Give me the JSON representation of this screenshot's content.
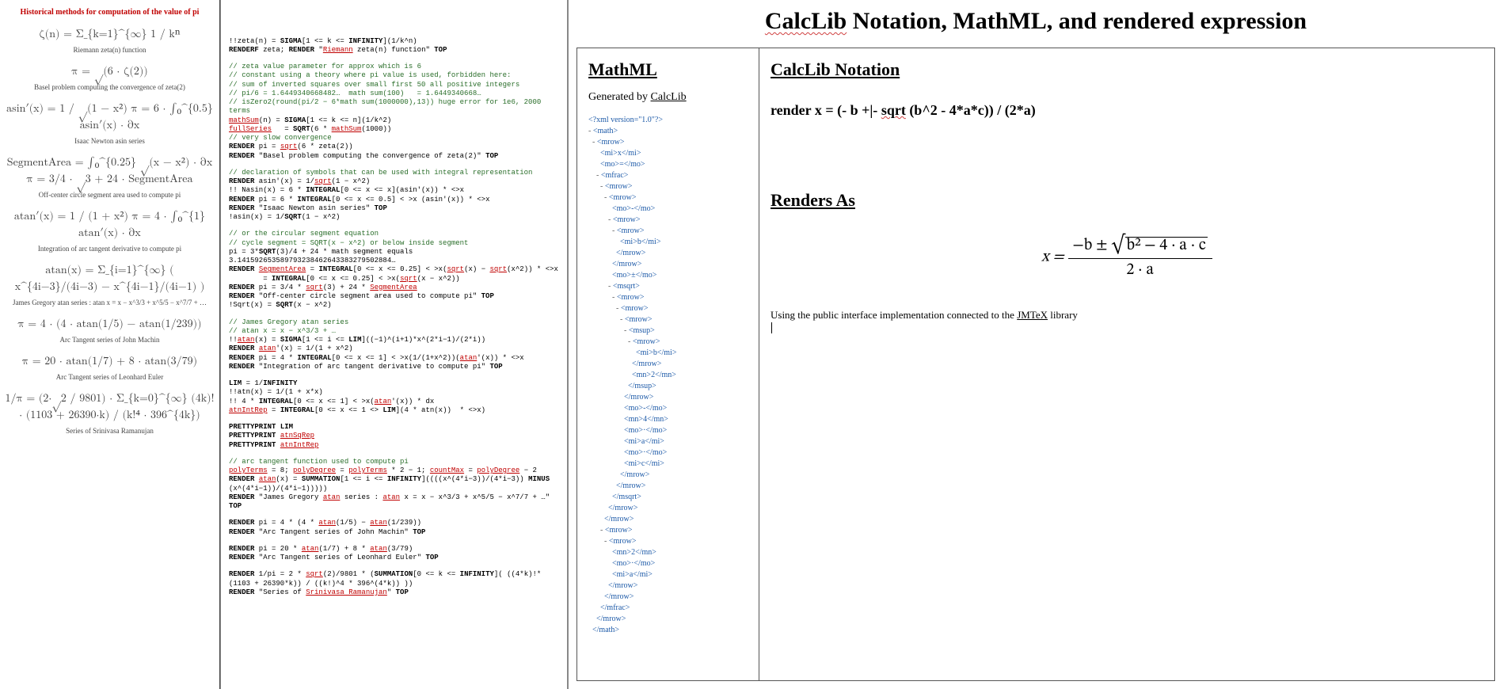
{
  "left": {
    "title": "Historical methods for computation of the value of pi",
    "items": [
      {
        "formula": "ζ(n) = Σ_{k=1}^{∞} 1 / kⁿ",
        "caption": "Riemann zeta(n) function"
      },
      {
        "formula": "π = √(6 · ζ(2))",
        "caption": "Basel problem computing the convergence of zeta(2)"
      },
      {
        "formula": "asin′(x) = 1 / √(1 − x²)\nπ = 6 · ∫₀^{0.5} asin′(x) · ∂x",
        "caption": "Isaac Newton asin series"
      },
      {
        "formula": "SegmentArea = ∫₀^{0.25} √(x − x²) · ∂x\nπ = 3/4 · √3 + 24 · SegmentArea",
        "caption": "Off-center circle segment area used to compute pi"
      },
      {
        "formula": "atan′(x) = 1 / (1 + x²)\nπ = 4 · ∫₀^{1} atan′(x) · ∂x",
        "caption": "Integration of arc tangent derivative to compute pi"
      },
      {
        "formula": "atan(x) = Σ_{i=1}^{∞} ( x^{4i−3}/(4i−3) − x^{4i−1}/(4i−1) )",
        "caption": "James Gregory atan series : atan x = x − x^3/3 + x^5/5 − x^7/7 + …"
      },
      {
        "formula": "π = 4 · (4 · atan(1/5) − atan(1/239))",
        "caption": "Arc Tangent series of John Machin"
      },
      {
        "formula": "π = 20 · atan(1/7) + 8 · atan(3/79)",
        "caption": "Arc Tangent series of Leonhard Euler"
      },
      {
        "formula": "1/π = (2·√2 / 9801) · Σ_{k=0}^{∞} (4k)! · (1103 + 26390·k) / (k!⁴ · 396^{4k})",
        "caption": "Series of Srinivasa Ramanujan"
      }
    ]
  },
  "middle": {
    "blocks": [
      [
        "!!zeta(n) = SIGMA[1 <= k <= INFINITY](1/k^n)",
        "RENDERF zeta; RENDER \"{Riemann} zeta(n) function\" TOP"
      ],
      [
        "// zeta value parameter for approx which is 6",
        "// constant using a theory where pi value is used, forbidden here:",
        "// sum of inverted squares over small first 50 all positive integers",
        "// pi/6 = 1.6449340668482…  math sum(100)   = 1.6449340668…",
        "// isZero2(round(pi/2 − 6*math sum(1000000),13)) huge error for 1e6, 2000 terms",
        "{mathSum}(n) = SIGMA[1 <= k <= n](1/k^2)",
        "{fullSeries}   = SQRT(6 * {mathSum}(1000))",
        "// very slow convergence",
        "RENDER pi = sqrt(6 * zeta(2))",
        "RENDER \"Basel problem computing the convergence of zeta(2)\" TOP"
      ],
      [
        "// declaration of symbols that can be used with integral representation",
        "",
        "RENDER asin'(x) = 1/sqrt(1 − x^2)",
        "!! Nasin(x) = 6 * INTEGRAL[0 <= x <= x](asin'(x)) * <>x",
        "RENDER pi = 6 * INTEGRAL[0 <= x <= 0.5] < >x (asin'(x)) * <>x",
        "RENDER \"Isaac Newton asin series\" TOP",
        "!asin(x) = 1/SQRT(1 − x^2)"
      ],
      [
        "// or the circular segment equation",
        "// cycle segment = SQRT(x − x^2) or below inside segment",
        "pi = 3*SQRT(3)/4 + 24 * math segment equals 3.141592653589793238462643383279502884…",
        "",
        "RENDER {SegmentArea} = INTEGRAL[0 <= x <= 0.25] < >x(sqrt(x) − sqrt(x^2)) * <>x",
        "        = INTEGRAL[0 <= x <= 0.25] < >x(sqrt(x − x^2))",
        "",
        "RENDER pi = 3/4 * sqrt(3) + 24 * {SegmentArea}",
        "RENDER \"Off-center circle segment area used to compute pi\" TOP",
        "!Sqrt(x) = SQRT(x − x^2)"
      ],
      [
        "// James Gregory atan series",
        "// atan x = x − x^3/3 + …",
        "!!atan(x) = SIGMA[1 <= i <= LIM]((−1)^(i+1)*x^(2*i−1)/(2*i))",
        "",
        "RENDER atan'(x) = 1/(1 + x^2)",
        "RENDER pi = 4 * INTEGRAL[0 <= x <= 1] < >x(1/(1+x^2))(atan'(x)) * <>x",
        "RENDER \"Integration of arc tangent derivative to compute pi\" TOP"
      ],
      [
        "LIM = 1/INFINITY",
        "!!atn(x) = 1/(1 + x*x)",
        "",
        "!! 4 * INTEGRAL[0 <= x <= 1] < >x(atan'(x)) * dx",
        "{atnIntRep} = INTEGRAL[0 <= x <= 1 <> LIM](4 * atn(x))  * <>x)"
      ],
      [
        "PRETTYPRINT LIM",
        "PRETTYPRINT {atnSqRep}",
        "PRETTYPRINT {atnIntRep}"
      ],
      [
        "// arc tangent function used to compute pi",
        "{polyTerms} = 8; {polyDegree} = {polyTerms} * 2 − 1; {countMax} = {polyDegree} − 2",
        "RENDER atan(x) = SUMMATION[1 <= i <= INFINITY]((((x^(4*i−3))/(4*i−3)) MINUS (x^(4*i−1))/(4*i−1)))))",
        "RENDER \"James Gregory atan series : atan x = x − x^3/3 + x^5/5 − x^7/7 + …\" TOP"
      ],
      [
        "RENDER pi = 4 * (4 * atan(1/5) − atan(1/239))",
        "RENDER \"Arc Tangent series of John Machin\" TOP"
      ],
      [
        "RENDER pi = 20 * atan(1/7) + 8 * atan(3/79)",
        "RENDER \"Arc Tangent series of Leonhard Euler\" TOP"
      ],
      [
        "RENDER 1/pi = 2 * sqrt(2)/9801 * (SUMMATION[0 <= k <= INFINITY]( ((4*k)!*(1103 + 26390*k)) / ((k!)^4 * 396^(4*k)) ))",
        "RENDER \"Series of {Srinivasa Ramanujan}\" TOP"
      ]
    ]
  },
  "right": {
    "title_parts": [
      "CalcLib",
      " Notation, MathML, and rendered expression"
    ],
    "mathml": {
      "heading": "MathML",
      "generated_prefix": "Generated by ",
      "generated_link": "CalcLib",
      "xml_lines": [
        "<?xml version=\"1.0\"?>",
        "- <math>",
        "  - <mrow>",
        "      <mi>x</mi>",
        "      <mo>=</mo>",
        "    - <mfrac>",
        "      - <mrow>",
        "        - <mrow>",
        "            <mo>-</mo>",
        "          - <mrow>",
        "            - <mrow>",
        "                <mi>b</mi>",
        "              </mrow>",
        "            </mrow>",
        "            <mo>±</mo>",
        "          - <msqrt>",
        "            - <mrow>",
        "              - <mrow>",
        "                - <mrow>",
        "                  - <msup>",
        "                    - <mrow>",
        "                        <mi>b</mi>",
        "                      </mrow>",
        "                      <mn>2</mn>",
        "                    </msup>",
        "                  </mrow>",
        "                  <mo>-</mo>",
        "                  <mn>4</mn>",
        "                  <mo>·</mo>",
        "                  <mi>a</mi>",
        "                  <mo>·</mo>",
        "                  <mi>c</mi>",
        "                </mrow>",
        "              </mrow>",
        "            </msqrt>",
        "          </mrow>",
        "        </mrow>",
        "      - <mrow>",
        "        - <mrow>",
        "            <mn>2</mn>",
        "            <mo>·</mo>",
        "            <mi>a</mi>",
        "          </mrow>",
        "        </mrow>",
        "      </mfrac>",
        "    </mrow>",
        "  </math>"
      ]
    },
    "calclib": {
      "heading": "CalcLib Notation",
      "notation": "render x = (- b +|- sqrt (b^2 - 4*a*c)) / (2*a)",
      "renders_heading": "Renders As",
      "formula": {
        "lhs": "x =",
        "num": "−b ± √(b² − 4·a·c)",
        "den": "2 · a",
        "num_neg_b": "−b ±",
        "num_under_root": "b² − 4 · a · c"
      },
      "note_prefix": "Using the public interface implementation connected to the ",
      "note_link": "JMTeX",
      "note_suffix": " library"
    }
  }
}
